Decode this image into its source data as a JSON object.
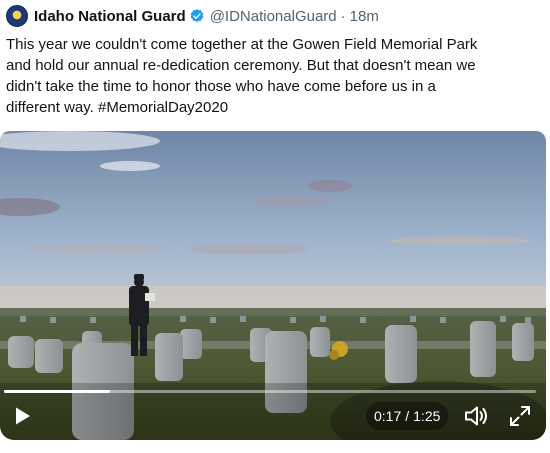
{
  "tweet": {
    "author_name": "Idaho National Guard",
    "handle": "@IDNationalGuard",
    "separator": "·",
    "timestamp": "18m",
    "text": "This year we couldn't come together at the Gowen Field Memorial Park\nand hold our annual re-dedication ceremony. But that doesn't mean we\ndidn't take the time to honor those who have come before us in a\ndifferent way. #MemorialDay2020",
    "verified_color": "#1d9bf0"
  },
  "video": {
    "current_time": "0:17",
    "time_separator": "/",
    "duration": "1:25",
    "progress_fraction": 0.2,
    "icons": {
      "play": "play-icon",
      "volume": "volume-icon",
      "fullscreen": "fullscreen-icon"
    }
  }
}
